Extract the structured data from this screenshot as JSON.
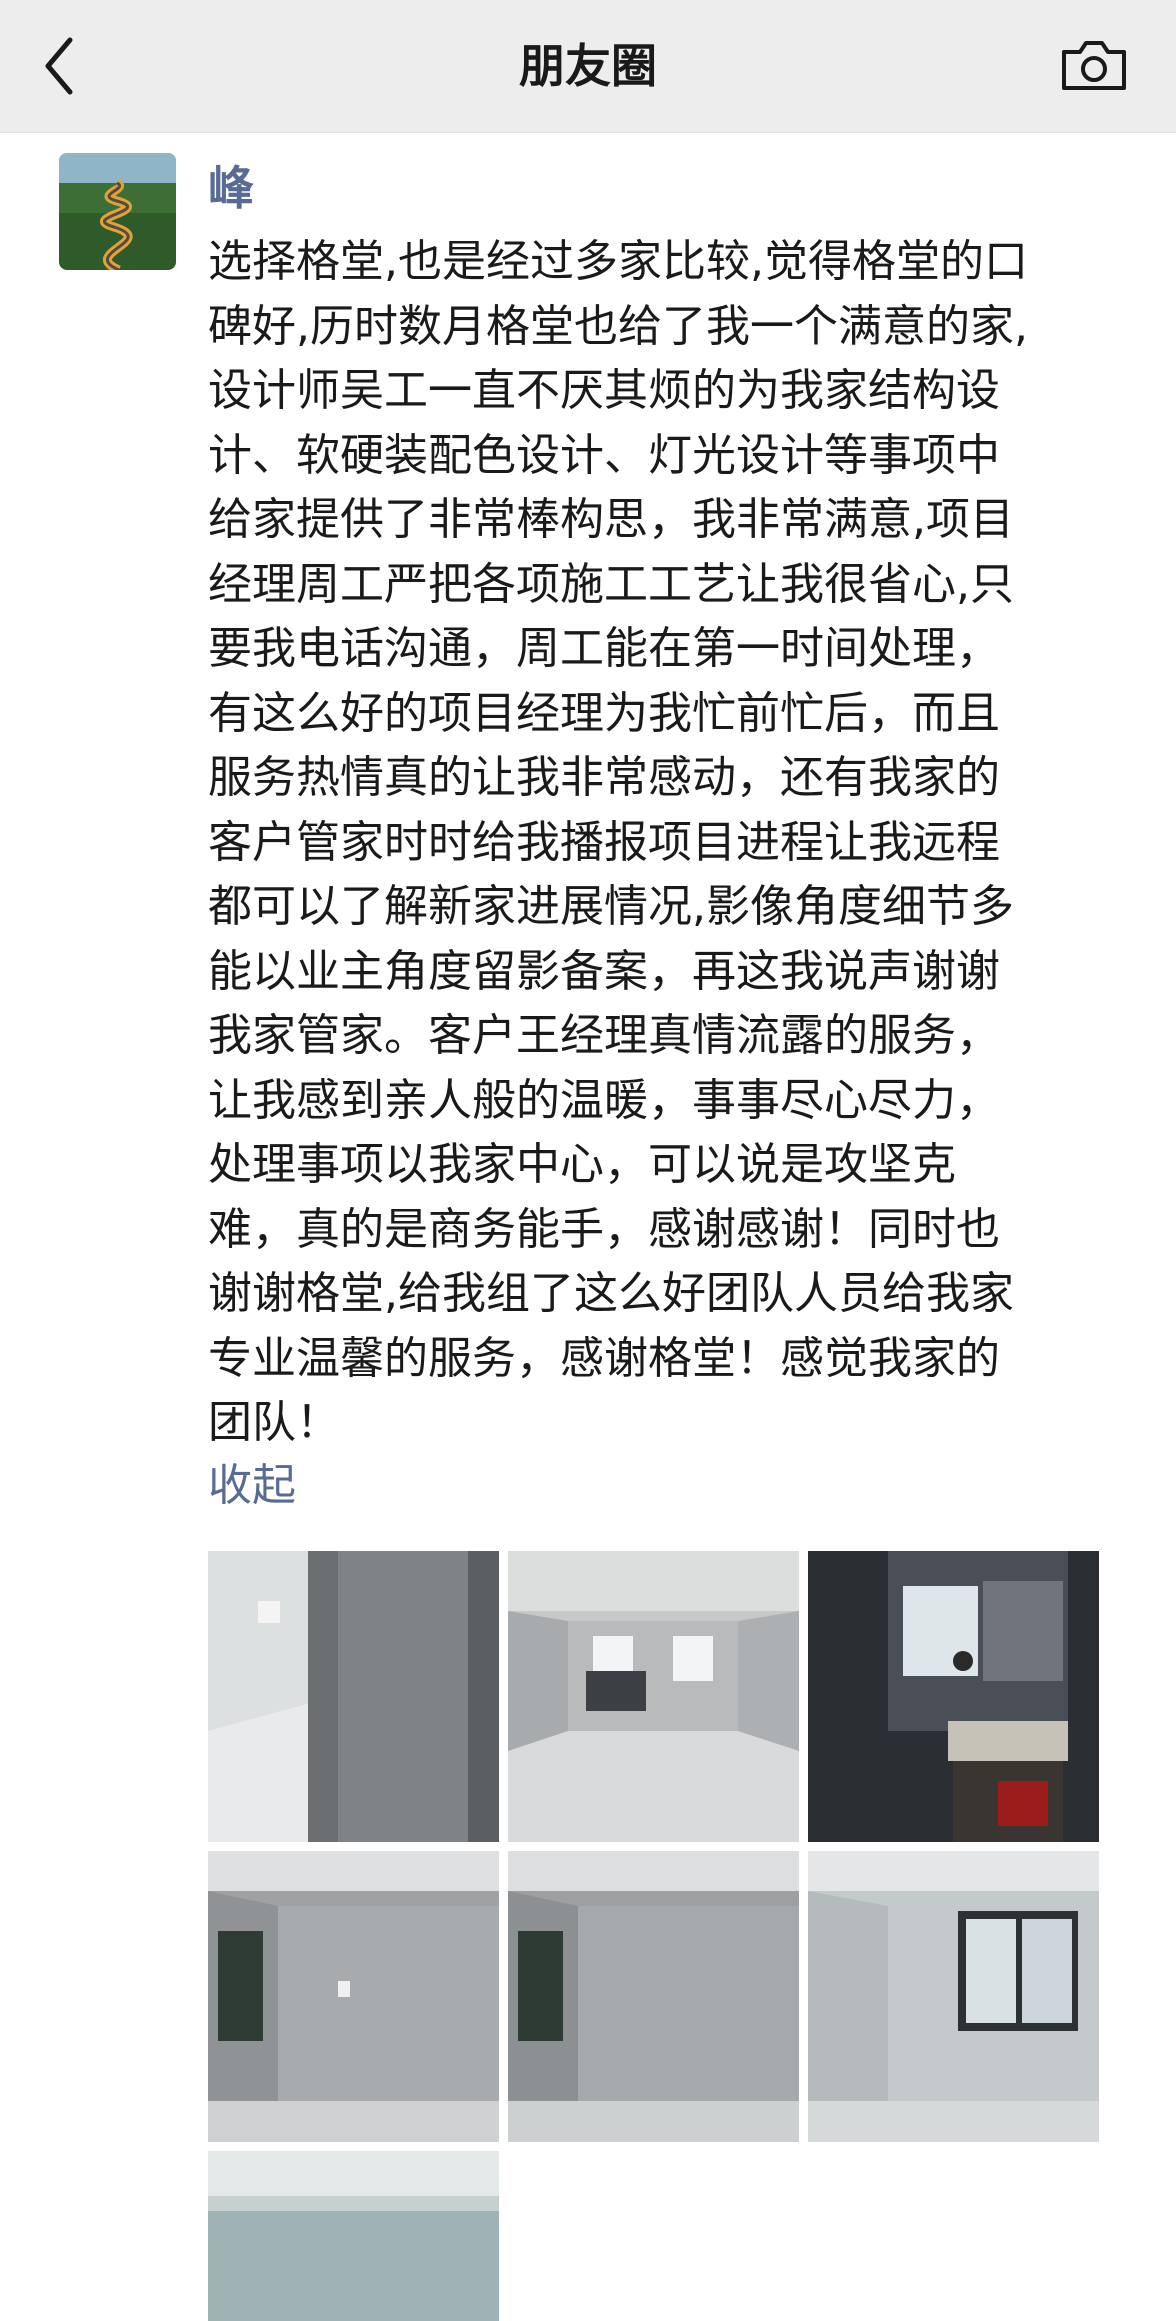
{
  "header": {
    "title": "朋友圈",
    "back_icon": "back-arrow-icon",
    "camera_icon": "camera-icon"
  },
  "post": {
    "author": "峰",
    "lines": [
      "选择格堂,也是经过多家比较,觉得格堂的口",
      "碑好,历时数月格堂也给了我一个满意的家,",
      "设计师吴工一直不厌其烦的为我家结构设",
      "计、软硬装配色设计、灯光设计等事项中",
      "给家提供了非常棒构思，我非常满意,项目",
      "经理周工严把各项施工工艺让我很省心,只",
      "要我电话沟通，周工能在第一时间处理，",
      "有这么好的项目经理为我忙前忙后，而且",
      "服务热情真的让我非常感动，还有我家的",
      "客户管家时时给我播报项目进程让我远程",
      "都可以了解新家进展情况,影像角度细节多",
      "能以业主角度留影备案，再这我说声谢谢",
      "我家管家。客户王经理真情流露的服务，",
      "让我感到亲人般的温暖，事事尽心尽力，",
      "处理事项以我家中心，可以说是攻坚克",
      "难，真的是商务能手，感谢感谢！同时也",
      "谢谢格堂,给我组了这么好团队人员给我家",
      "专业温馨的服务，感谢格堂！感觉我家的",
      "团队！"
    ],
    "collapse_label": "收起",
    "link_color": "#576b95"
  }
}
